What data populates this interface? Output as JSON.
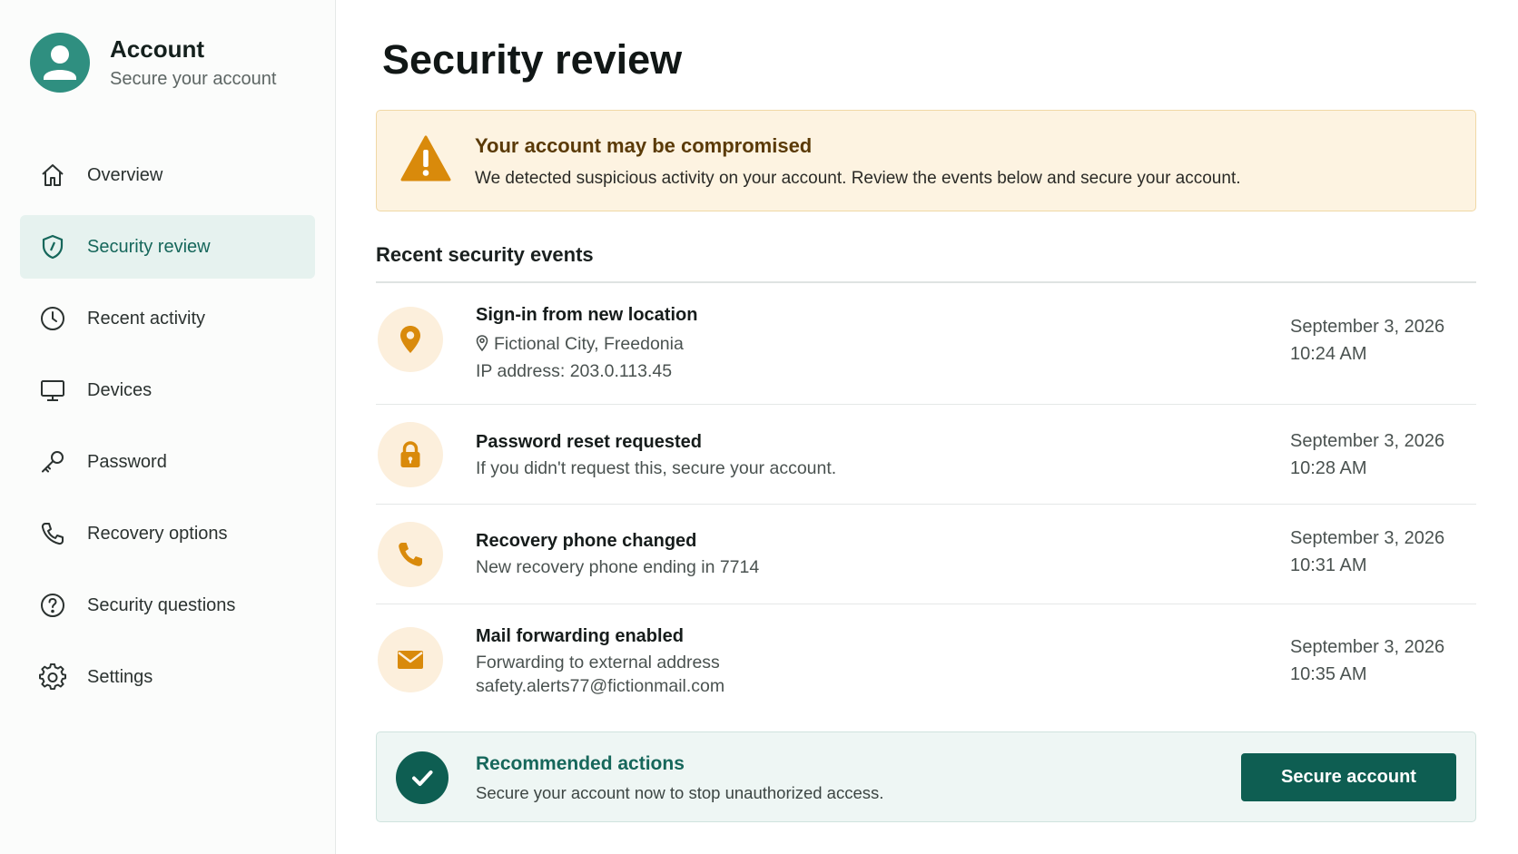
{
  "profile": {
    "title": "Account",
    "subtitle": "Secure your account",
    "avatar_icon": "user-avatar-icon"
  },
  "sidebar": {
    "items": [
      {
        "label": "Overview",
        "icon": "home-icon",
        "active": false
      },
      {
        "label": "Security review",
        "icon": "shield-icon",
        "active": true
      },
      {
        "label": "Recent activity",
        "icon": "clock-icon",
        "active": false
      },
      {
        "label": "Devices",
        "icon": "monitor-icon",
        "active": false
      },
      {
        "label": "Password",
        "icon": "key-icon",
        "active": false
      },
      {
        "label": "Recovery options",
        "icon": "phone-icon",
        "active": false
      },
      {
        "label": "Security questions",
        "icon": "question-icon",
        "active": false
      },
      {
        "label": "Settings",
        "icon": "gear-icon",
        "active": false
      }
    ]
  },
  "page": {
    "title": "Security review"
  },
  "alert": {
    "icon": "warning-icon",
    "title": "Your account may be compromised",
    "text": "We detected suspicious activity on your account. Review the events below and secure your account."
  },
  "events_section": {
    "title": "Recent security events"
  },
  "events": [
    {
      "icon": "location-pin-icon",
      "title": "Sign-in from new location",
      "location": "Fictional City, Freedonia",
      "detail": "IP address: 203.0.113.45",
      "date": "September 3, 2026",
      "time": "10:24 AM"
    },
    {
      "icon": "lock-icon",
      "title": "Password reset requested",
      "detail": "If you didn't request this, secure your account.",
      "date": "September 3, 2026",
      "time": "10:28 AM"
    },
    {
      "icon": "phone-icon",
      "title": "Recovery phone changed",
      "detail": "New recovery phone ending in 7714",
      "date": "September 3, 2026",
      "time": "10:31 AM"
    },
    {
      "icon": "mail-icon",
      "title": "Mail forwarding enabled",
      "detail": "Forwarding to external address",
      "detail2": "safety.alerts77@fictionmail.com",
      "date": "September 3, 2026",
      "time": "10:35 AM"
    }
  ],
  "recommendation": {
    "icon": "check-circle-icon",
    "title": "Recommended actions",
    "text": "Secure your account now to stop unauthorized access.",
    "button_label": "Secure account"
  },
  "colors": {
    "accent": "#0e5e52",
    "warning": "#d98a0b",
    "warning_bg": "#fdf3e1",
    "icon_bg": "#fcefdc"
  }
}
